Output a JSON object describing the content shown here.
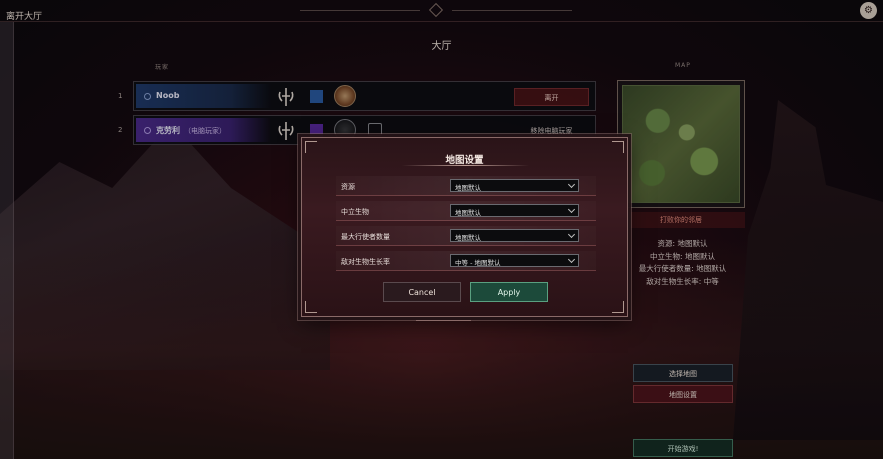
{
  "window": {
    "leave_lobby": "离开大厅"
  },
  "page": {
    "title": "大厅"
  },
  "players": {
    "column_label": "玩家",
    "rows": [
      {
        "index": "1",
        "name": "Noob",
        "sub": "",
        "action": "离开"
      },
      {
        "index": "2",
        "name": "克劳利",
        "sub": "（电脑玩家）",
        "action": "移除电脑玩家"
      }
    ]
  },
  "map_panel": {
    "label": "MAP",
    "name": "打败你的邻居",
    "info": [
      "资源: 地图默认",
      "中立生物: 地图默认",
      "最大行使者数量: 地图默认",
      "敌对生物生长率: 中等"
    ],
    "select_map": "选择地图",
    "map_settings": "地图设置",
    "start_game": "开始游戏!"
  },
  "dialog": {
    "title": "地图设置",
    "settings": [
      {
        "label": "资源",
        "value": "地图默认"
      },
      {
        "label": "中立生物",
        "value": "地图默认"
      },
      {
        "label": "最大行使者数量",
        "value": "地图默认"
      },
      {
        "label": "敌对生物生长率",
        "value": "中等 - 地图默认"
      }
    ],
    "cancel": "Cancel",
    "apply": "Apply"
  },
  "colors": {
    "accent_red": "#501418",
    "accent_green": "#1c4a3a",
    "blue_player": "#1f3a6a",
    "purple_player": "#4a2a8a"
  },
  "icons": [
    "settings-icon",
    "race-emblem-icon",
    "hero-portrait-icon",
    "chevron-down-icon"
  ]
}
